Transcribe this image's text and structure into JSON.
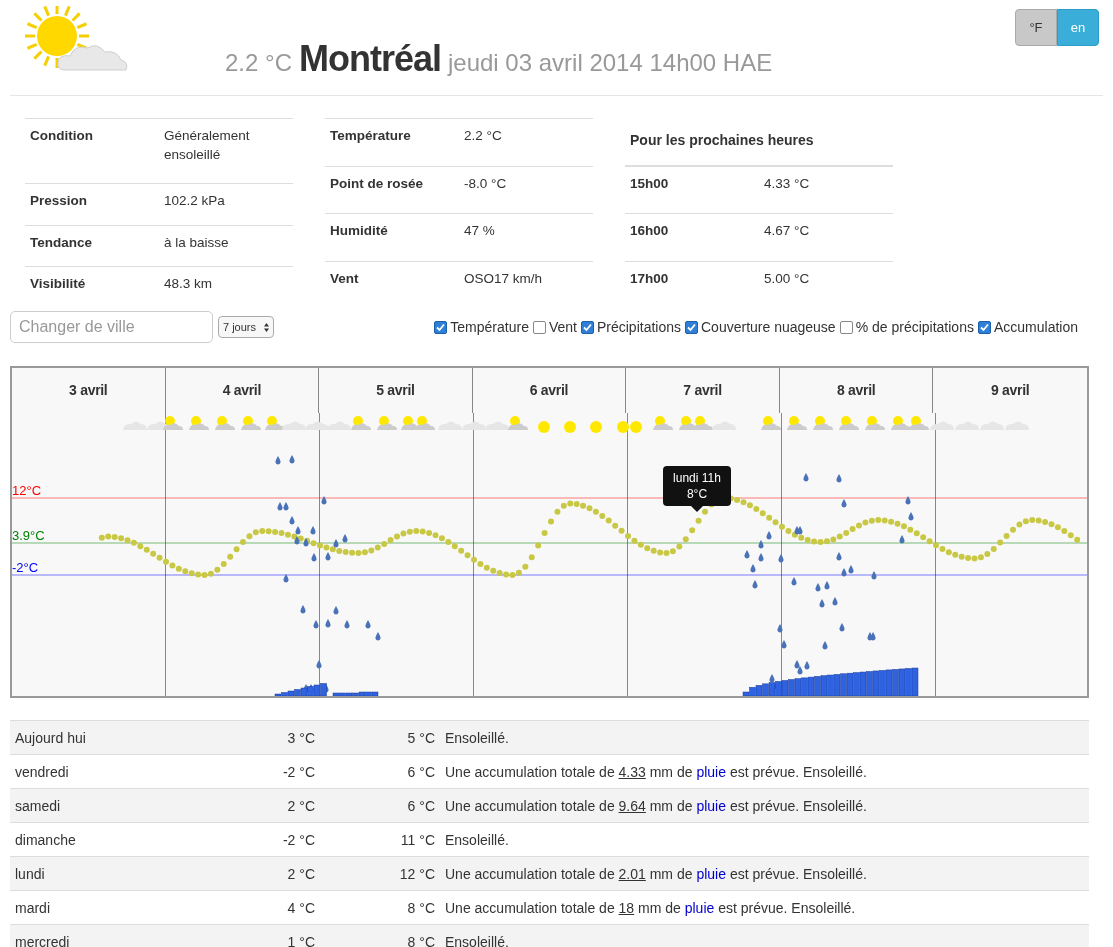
{
  "header": {
    "temperature": "2.2 °C",
    "city": "Montréal",
    "datetime": "jeudi 03 avril 2014 14h00 HAE"
  },
  "toggles": [
    {
      "label": "°F",
      "selected": false
    },
    {
      "label": "en",
      "selected": true
    }
  ],
  "conditions": [
    {
      "label": "Condition",
      "value": "Généralement ensoleillé"
    },
    {
      "label": "Pression",
      "value": "102.2 kPa"
    },
    {
      "label": "Tendance",
      "value": "à la baisse"
    },
    {
      "label": "Visibilité",
      "value": "48.3 km"
    }
  ],
  "measures": [
    {
      "label": "Température",
      "value": "2.2 °C"
    },
    {
      "label": "Point de rosée",
      "value": "-8.0 °C"
    },
    {
      "label": "Humidité",
      "value": "47 %"
    },
    {
      "label": "Vent",
      "value": "OSO17 km/h"
    }
  ],
  "next_hours": {
    "title": "Pour les prochaines heures",
    "rows": [
      {
        "hour": "15h00",
        "value": "4.33 °C"
      },
      {
        "hour": "16h00",
        "value": "4.67 °C"
      },
      {
        "hour": "17h00",
        "value": "5.00 °C"
      }
    ]
  },
  "city_search": {
    "placeholder": "Changer de ville"
  },
  "period_select": {
    "value": "7 jours"
  },
  "layers": [
    {
      "label": "Température",
      "checked": true
    },
    {
      "label": "Vent",
      "checked": false
    },
    {
      "label": "Précipitations",
      "checked": true
    },
    {
      "label": "Couverture nuageuse",
      "checked": true
    },
    {
      "label": "% de précipitations",
      "checked": false
    },
    {
      "label": "Accumulation",
      "checked": true
    }
  ],
  "chart": {
    "days": [
      "3 avril",
      "4 avril",
      "5 avril",
      "6 avril",
      "7 avril",
      "8 avril",
      "9 avril"
    ],
    "reference_lines": [
      {
        "label": "12°C",
        "color": "#ff0000"
      },
      {
        "label": "3.9°C",
        "color": "#008000"
      },
      {
        "label": "-2°C",
        "color": "#0000ff"
      }
    ],
    "tooltip": {
      "title": "lundi 11h",
      "value": "8°C"
    }
  },
  "forecast": [
    {
      "day": "Aujourd hui",
      "min": "3 °C",
      "max": "5 °C",
      "kind": "plain",
      "text": "Ensoleillé."
    },
    {
      "day": "vendredi",
      "min": "-2 °C",
      "max": "6 °C",
      "kind": "rain",
      "before": "Une accumulation totale de",
      "amount": "4.33",
      "middle": "mm de",
      "link": "pluie",
      "after": "est prévue. Ensoleillé."
    },
    {
      "day": "samedi",
      "min": "2 °C",
      "max": "6 °C",
      "kind": "rain",
      "before": "Une accumulation totale de",
      "amount": "9.64",
      "middle": "mm de",
      "link": "pluie",
      "after": "est prévue. Ensoleillé."
    },
    {
      "day": "dimanche",
      "min": "-2 °C",
      "max": "11 °C",
      "kind": "plain",
      "text": "Ensoleillé."
    },
    {
      "day": "lundi",
      "min": "2 °C",
      "max": "12 °C",
      "kind": "rain",
      "before": "Une accumulation totale de",
      "amount": "2.01",
      "middle": "mm de",
      "link": "pluie",
      "after": "est prévue. Ensoleillé."
    },
    {
      "day": "mardi",
      "min": "4 °C",
      "max": "8 °C",
      "kind": "rain",
      "before": "Une accumulation totale de",
      "amount": "18",
      "middle": "mm de",
      "link": "pluie",
      "after": "est prévue. Ensoleillé."
    },
    {
      "day": "mercredi",
      "min": "1 °C",
      "max": "8 °C",
      "kind": "plain",
      "text": "Ensoleillé."
    }
  ]
}
